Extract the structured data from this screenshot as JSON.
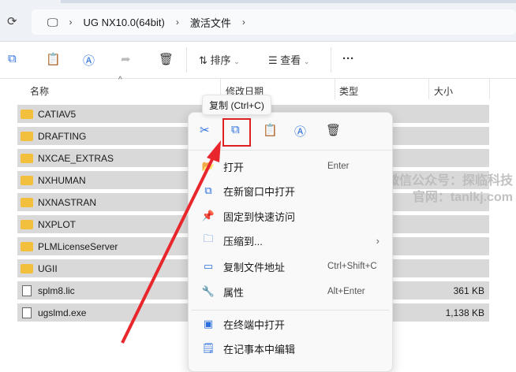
{
  "breadcrumb": [
    "UG NX10.0(64bit)",
    "激活文件"
  ],
  "toolbar": {
    "sort": "排序",
    "view": "查看",
    "more": "···"
  },
  "columns": {
    "name": "名称",
    "date": "修改日期",
    "type": "类型",
    "size": "大小"
  },
  "files": [
    {
      "name": "CATIAV5",
      "kind": "folder",
      "size": ""
    },
    {
      "name": "DRAFTING",
      "kind": "folder",
      "size": ""
    },
    {
      "name": "NXCAE_EXTRAS",
      "kind": "folder",
      "size": ""
    },
    {
      "name": "NXHUMAN",
      "kind": "folder",
      "size": ""
    },
    {
      "name": "NXNASTRAN",
      "kind": "folder",
      "size": ""
    },
    {
      "name": "NXPLOT",
      "kind": "folder",
      "size": ""
    },
    {
      "name": "PLMLicenseServer",
      "kind": "folder",
      "size": ""
    },
    {
      "name": "UGII",
      "kind": "folder",
      "size": ""
    },
    {
      "name": "splm8.lic",
      "kind": "file",
      "size": "361 KB"
    },
    {
      "name": "ugslmd.exe",
      "kind": "file",
      "size": "1,138 KB"
    }
  ],
  "tooltip": "复制 (Ctrl+C)",
  "menu": {
    "items": [
      {
        "label": "打开",
        "shortcut": "Enter",
        "icon": "folder-open-icon"
      },
      {
        "label": "在新窗口中打开",
        "shortcut": "",
        "icon": "new-window-icon"
      },
      {
        "label": "固定到快速访问",
        "shortcut": "",
        "icon": "pin-icon"
      },
      {
        "label": "压缩到...",
        "shortcut": "",
        "icon": "zip-icon"
      },
      {
        "label": "复制文件地址",
        "shortcut": "Ctrl+Shift+C",
        "icon": "path-icon"
      },
      {
        "label": "属性",
        "shortcut": "Alt+Enter",
        "icon": "wrench-icon"
      },
      {
        "label": "在终端中打开",
        "shortcut": "",
        "icon": "terminal-icon"
      },
      {
        "label": "在记事本中编辑",
        "shortcut": "",
        "icon": "notepad-icon"
      }
    ]
  },
  "watermark": {
    "line1": "微信公众号：探临科技",
    "line2": "官网：tanlkj.com"
  },
  "colors": {
    "highlight": "#e02020",
    "arrow": "#e8262b"
  }
}
